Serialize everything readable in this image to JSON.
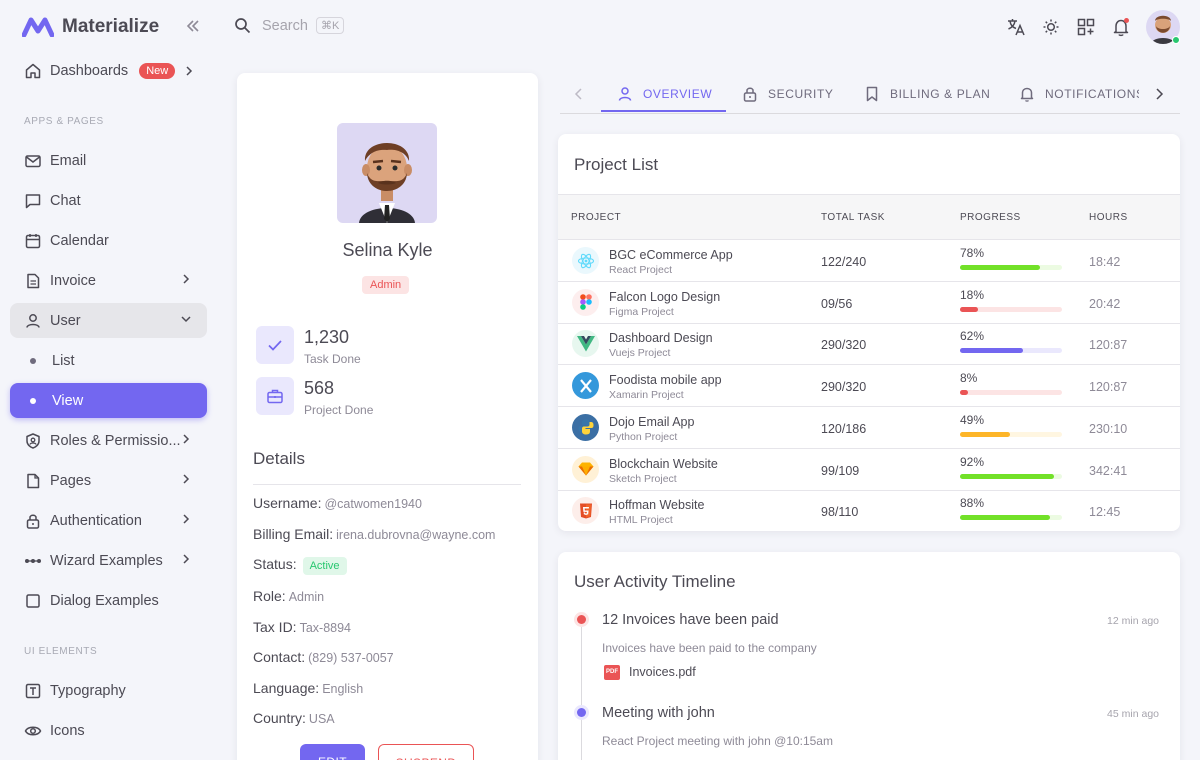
{
  "app": {
    "name": "Materialize"
  },
  "sidebar": {
    "dashboards": {
      "label": "Dashboards",
      "badge": "New"
    },
    "section_apps": "APPS & PAGES",
    "section_ui": "UI ELEMENTS",
    "items": [
      {
        "label": "Email"
      },
      {
        "label": "Chat"
      },
      {
        "label": "Calendar"
      },
      {
        "label": "Invoice"
      },
      {
        "label": "User"
      },
      {
        "label": "List"
      },
      {
        "label": "View"
      },
      {
        "label": "Roles & Permissio..."
      },
      {
        "label": "Pages"
      },
      {
        "label": "Authentication"
      },
      {
        "label": "Wizard Examples"
      },
      {
        "label": "Dialog Examples"
      },
      {
        "label": "Typography"
      },
      {
        "label": "Icons"
      }
    ]
  },
  "search": {
    "placeholder": "Search",
    "shortcut": "⌘K"
  },
  "profile": {
    "name": "Selina Kyle",
    "role": "Admin",
    "stats": [
      {
        "value": "1,230",
        "label": "Task Done"
      },
      {
        "value": "568",
        "label": "Project Done"
      }
    ],
    "details_title": "Details",
    "details": [
      {
        "label": "Username:",
        "value": "@catwomen1940"
      },
      {
        "label": "Billing Email:",
        "value": "irena.dubrovna@wayne.com"
      },
      {
        "label": "Status:",
        "value": "Active"
      },
      {
        "label": "Role:",
        "value": "Admin"
      },
      {
        "label": "Tax ID:",
        "value": "Tax-8894"
      },
      {
        "label": "Contact:",
        "value": "(829) 537-0057"
      },
      {
        "label": "Language:",
        "value": "English"
      },
      {
        "label": "Country:",
        "value": "USA"
      }
    ],
    "edit_label": "EDIT",
    "suspend_label": "SUSPEND"
  },
  "tabs": [
    {
      "label": "OVERVIEW"
    },
    {
      "label": "SECURITY"
    },
    {
      "label": "BILLING & PLAN"
    },
    {
      "label": "NOTIFICATIONS"
    }
  ],
  "project_list": {
    "title": "Project List",
    "headers": [
      "PROJECT",
      "TOTAL TASK",
      "PROGRESS",
      "HOURS"
    ],
    "rows": [
      {
        "name": "BGC eCommerce App",
        "type": "React Project",
        "task": "122/240",
        "progress_label": "78%",
        "progress": 78,
        "hours": "18:42",
        "color": "#72e128",
        "track": "#ecfbe2",
        "icon": "react-icon"
      },
      {
        "name": "Falcon Logo Design",
        "type": "Figma Project",
        "task": "09/56",
        "progress_label": "18%",
        "progress": 18,
        "hours": "20:42",
        "color": "#ea5455",
        "track": "#fce4e4",
        "icon": "figma-icon"
      },
      {
        "name": "Dashboard Design",
        "type": "Vuejs Project",
        "task": "290/320",
        "progress_label": "62%",
        "progress": 62,
        "hours": "120:87",
        "color": "#7367f0",
        "track": "#eae8fd",
        "icon": "vue-icon"
      },
      {
        "name": "Foodista mobile app",
        "type": "Xamarin Project",
        "task": "290/320",
        "progress_label": "8%",
        "progress": 8,
        "hours": "120:87",
        "color": "#ea5455",
        "track": "#fce4e4",
        "icon": "xamarin-icon"
      },
      {
        "name": "Dojo Email App",
        "type": "Python Project",
        "task": "120/186",
        "progress_label": "49%",
        "progress": 49,
        "hours": "230:10",
        "color": "#fdb528",
        "track": "#fff6e1",
        "icon": "python-icon"
      },
      {
        "name": "Blockchain Website",
        "type": "Sketch Project",
        "task": "99/109",
        "progress_label": "92%",
        "progress": 92,
        "hours": "342:41",
        "color": "#72e128",
        "track": "#ecfbe2",
        "icon": "sketch-icon"
      },
      {
        "name": "Hoffman Website",
        "type": "HTML Project",
        "task": "98/110",
        "progress_label": "88%",
        "progress": 88,
        "hours": "12:45",
        "color": "#72e128",
        "track": "#ecfbe2",
        "icon": "html5-icon"
      }
    ]
  },
  "timeline": {
    "title": "User Activity Timeline",
    "events": [
      {
        "title": "12 Invoices have been paid",
        "time": "12 min ago",
        "desc": "Invoices have been paid to the company",
        "file": "Invoices.pdf",
        "file_badge": "PDF",
        "color": "#ea5455"
      },
      {
        "title": "Meeting with john",
        "time": "45 min ago",
        "desc": "React Project meeting with john @10:15am",
        "color": "#7367f0"
      }
    ]
  }
}
